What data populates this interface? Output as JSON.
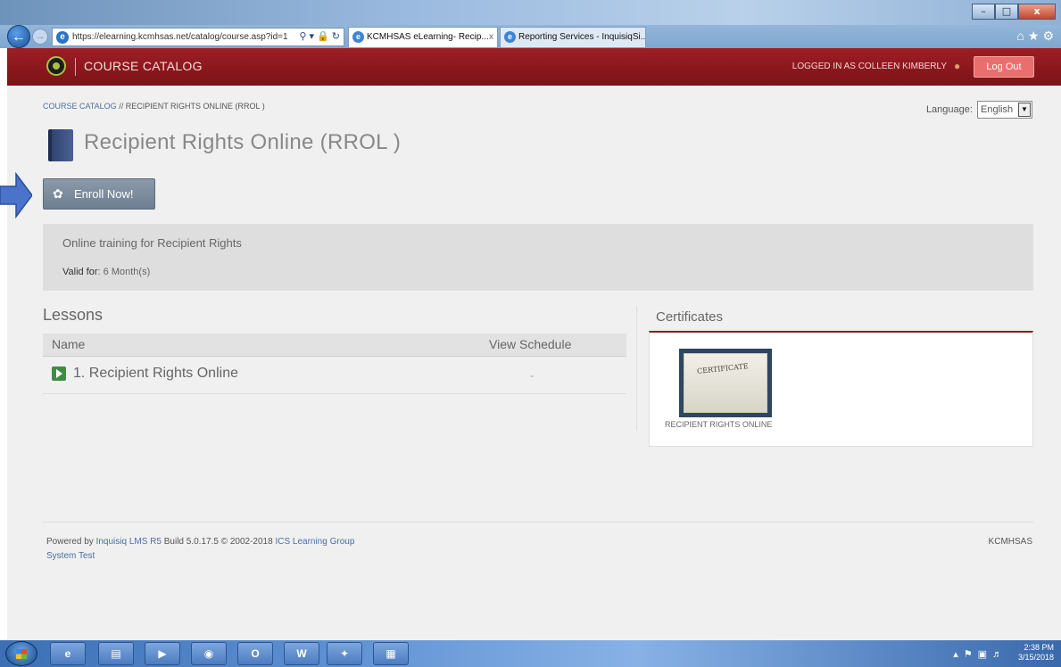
{
  "browser": {
    "url": "https://elearning.kcmhsas.net/catalog/course.asp?id=1",
    "tabs": [
      {
        "title": "KCMHSAS eLearning- Recip...",
        "active": true
      },
      {
        "title": "Reporting Services - InquisiqSi...",
        "active": false
      }
    ],
    "close_label": "x"
  },
  "header": {
    "section_title": "COURSE CATALOG",
    "logged_in_text": "LOGGED IN AS COLLEEN KIMBERLY",
    "logout_label": "Log Out"
  },
  "breadcrumb": {
    "link": "COURSE CATALOG",
    "separator": " // ",
    "current": "RECIPIENT RIGHTS ONLINE (RROL )"
  },
  "language": {
    "label": "Language:",
    "selected": "English"
  },
  "course": {
    "title": "Recipient Rights Online (RROL )",
    "enroll_label": "Enroll Now!",
    "description": "Online training for Recipient Rights",
    "valid_label": "Valid for",
    "valid_value": ": 6 Month(s)"
  },
  "lessons": {
    "title": "Lessons",
    "columns": [
      "Name",
      "View Schedule"
    ],
    "rows": [
      {
        "name": "1. Recipient Rights Online",
        "schedule": "-"
      }
    ]
  },
  "certificates": {
    "title": "Certificates",
    "items": [
      {
        "image_text": "CERTIFICATE",
        "label": "RECIPIENT RIGHTS ONLINE"
      }
    ]
  },
  "footer": {
    "powered_prefix": "Powered by ",
    "product_link": "Inquisiq LMS R5",
    "build_text": " Build 5.0.17.5  © 2002-2018  ",
    "company_link": "ICS Learning Group",
    "system_test": "System Test",
    "org": "KCMHSAS"
  },
  "taskbar": {
    "time": "2:38 PM",
    "date": "3/15/2018"
  },
  "colors": {
    "header_red": "#8a1d22",
    "logout_button": "#e86f6d",
    "enroll_button": "#7c8c9c",
    "link_blue": "#4a6fa0"
  }
}
